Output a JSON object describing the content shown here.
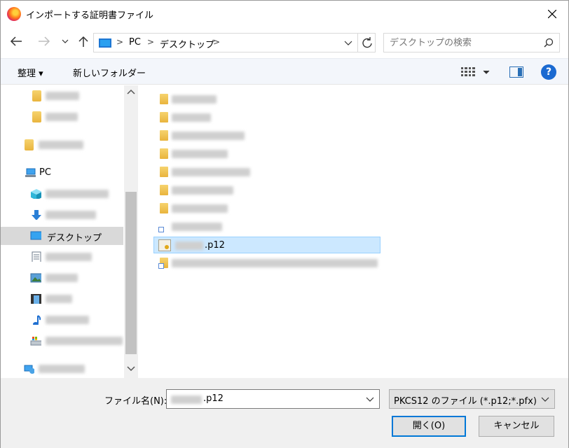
{
  "window": {
    "title": "インポートする証明書ファイル"
  },
  "nav": {
    "breadcrumb": [
      "PC",
      "デスクトップ"
    ],
    "search_placeholder": "デスクトップの検索"
  },
  "toolbar": {
    "organize_label": "整理 ▾",
    "new_folder_label": "新しいフォルダー"
  },
  "navpane": {
    "pc_label": "PC",
    "desktop_label": "デスクトップ"
  },
  "files": {
    "selected_file_label": ".p12"
  },
  "bottom": {
    "filename_label": "ファイル名(N):",
    "filename_value": ".p12",
    "filetype_value": "PKCS12 のファイル (*.p12;*.pfx)",
    "open_label": "開く(O)",
    "cancel_label": "キャンセル"
  },
  "colors": {
    "selection_bg": "#cce8ff",
    "accent": "#0078d7",
    "help": "#1b6ad1"
  }
}
